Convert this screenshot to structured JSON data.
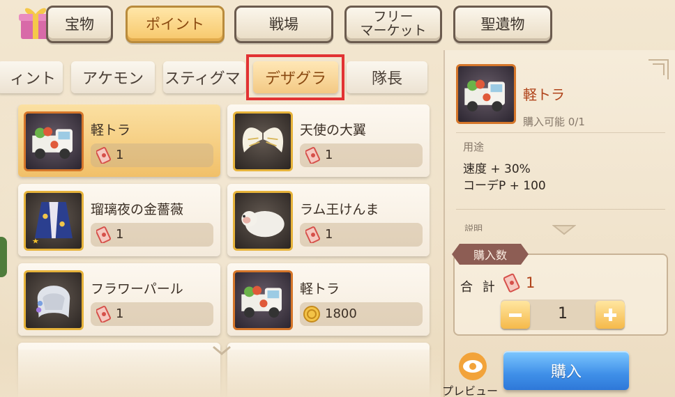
{
  "top_tabs": [
    {
      "label": "宝物",
      "active": false
    },
    {
      "label": "ポイント",
      "active": true
    },
    {
      "label": "戦場",
      "active": false
    },
    {
      "label": "フリー\nマーケット",
      "active": false
    },
    {
      "label": "聖遺物",
      "active": false
    }
  ],
  "sub_tabs": [
    {
      "label": "ィント",
      "active": false
    },
    {
      "label": "アケモン",
      "active": false
    },
    {
      "label": "スティグマ",
      "active": false
    },
    {
      "label": "デザグラ",
      "active": true
    },
    {
      "label": "隊長",
      "active": false
    }
  ],
  "items": [
    {
      "name": "軽トラ",
      "price": "1",
      "currency": "ticket-icon",
      "selected": true
    },
    {
      "name": "天使の大翼",
      "price": "1",
      "currency": "ticket-icon",
      "selected": false
    },
    {
      "name": "瑠璃夜の金薔薇",
      "price": "1",
      "currency": "ticket-icon",
      "selected": false
    },
    {
      "name": "ラム王けんま",
      "price": "1",
      "currency": "ticket-icon",
      "selected": false
    },
    {
      "name": "フラワーパール",
      "price": "1",
      "currency": "ticket-icon",
      "selected": false
    },
    {
      "name": "軽トラ",
      "price": "1800",
      "currency": "coin-icon",
      "selected": false
    }
  ],
  "detail": {
    "name": "軽トラ",
    "availability": "購入可能 0/1",
    "usage_label": "用途",
    "stat1": "速度 + 30%",
    "stat2": "コーデP + 100",
    "description_label": "説明"
  },
  "purchase": {
    "quantity_label": "購入数",
    "total_label": "合 計",
    "total_value": "1",
    "quantity": "1",
    "preview_label": "プレビュー",
    "buy_label": "購入"
  },
  "colors": {
    "highlight": "#e23233",
    "buy_button": "#3f8fe8",
    "active_tab": "#f7c76a"
  }
}
